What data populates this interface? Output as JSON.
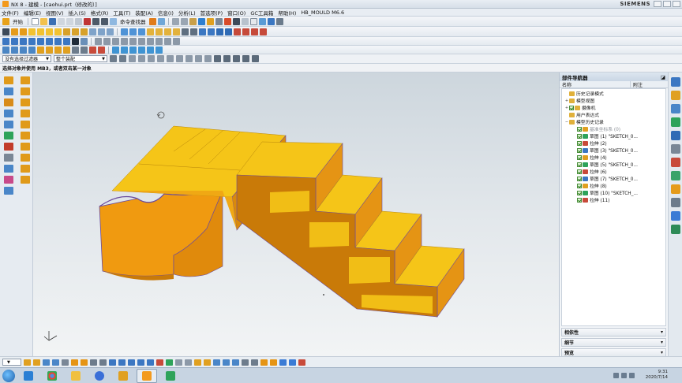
{
  "window": {
    "title": "NX 8 - 建模 - [caohui.prt（修改的）]",
    "brand": "SIEMENS"
  },
  "menu": {
    "items": [
      "文件(F)",
      "编辑(E)",
      "视图(V)",
      "插入(S)",
      "格式(R)",
      "工具(T)",
      "装配(A)",
      "信息(I)",
      "分析(L)",
      "首选项(P)",
      "窗口(O)",
      "GC工具箱",
      "帮助(H)",
      "HB_MOULD M6.6"
    ]
  },
  "toolbar": {
    "start_label": "开始",
    "command_finder_label": "命令查找器"
  },
  "filter": {
    "type_filter": "没有选择过滤器",
    "scope": "整个装配"
  },
  "cue": {
    "text": "选择对象并使用 MB3，或者双击某一对象"
  },
  "navigator": {
    "title": "部件导航器",
    "col_name": "名称",
    "col_note": "附注",
    "items": [
      {
        "label": "历史记录模式",
        "level": 0,
        "expander": "",
        "check": false
      },
      {
        "label": "模型视图",
        "level": 0,
        "expander": "+",
        "check": false
      },
      {
        "label": "摄像机",
        "level": 0,
        "expander": "+",
        "check": true
      },
      {
        "label": "用户表达式",
        "level": 0,
        "expander": "",
        "check": false
      },
      {
        "label": "模型历史记录",
        "level": 0,
        "expander": "−",
        "check": false
      },
      {
        "label": "基准坐标系 (0)",
        "level": 1,
        "expander": "",
        "check": true,
        "muted": true
      },
      {
        "label": "草图 (1) \"SKETCH_0...",
        "level": 1,
        "expander": "",
        "check": true
      },
      {
        "label": "拉伸 (2)",
        "level": 1,
        "expander": "",
        "check": true
      },
      {
        "label": "草图 (3) \"SKETCH_0...",
        "level": 1,
        "expander": "",
        "check": true
      },
      {
        "label": "拉伸 (4)",
        "level": 1,
        "expander": "",
        "check": true
      },
      {
        "label": "草图 (5) \"SKETCH_0...",
        "level": 1,
        "expander": "",
        "check": true
      },
      {
        "label": "拉伸 (6)",
        "level": 1,
        "expander": "",
        "check": true
      },
      {
        "label": "草图 (7) \"SKETCH_0...",
        "level": 1,
        "expander": "",
        "check": true
      },
      {
        "label": "拉伸 (8)",
        "level": 1,
        "expander": "",
        "check": true
      },
      {
        "label": "草图 (10) \"SKETCH_...",
        "level": 1,
        "expander": "",
        "check": true
      },
      {
        "label": "拉伸 (11)",
        "level": 1,
        "expander": "",
        "check": true
      }
    ],
    "panels": [
      "相依性",
      "细节",
      "预览"
    ]
  },
  "taskbar": {
    "time": "9:31",
    "date": "2020/7/14"
  },
  "colors": {
    "model_top": "#f5c518",
    "model_side_light": "#f09a10",
    "model_side_dark": "#c97a08",
    "model_edge": "#6a4a9e",
    "viewport_top": "#cdd6dd",
    "viewport_bottom": "#f2f4f5"
  },
  "icons": {
    "rotate_cursor": "rotate-cursor-icon",
    "triad": "wcs-triad-icon"
  }
}
